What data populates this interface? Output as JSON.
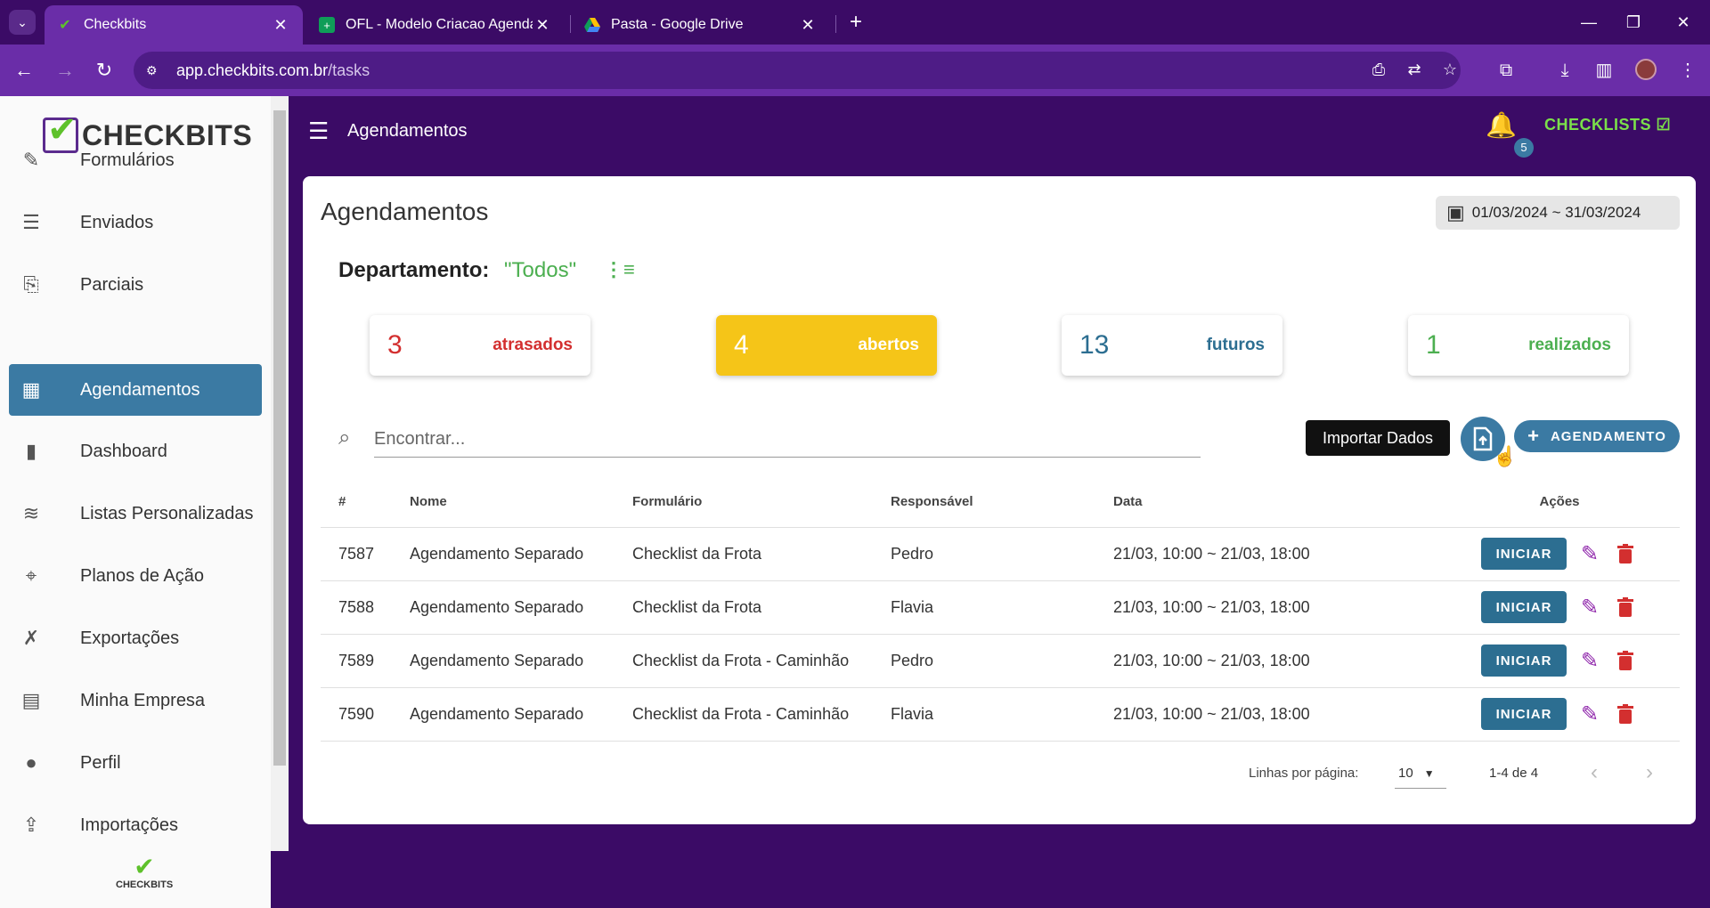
{
  "browser": {
    "tabs": [
      {
        "title": "Checkbits",
        "active": true
      },
      {
        "title": "OFL - Modelo Criacao Agendam",
        "active": false
      },
      {
        "title": "Pasta - Google Drive",
        "active": false
      }
    ],
    "url_host": "app.checkbits.com.br",
    "url_path": "/tasks"
  },
  "sidebar": {
    "logo_text": "CHECKBITS",
    "items": [
      {
        "label": "Formulários",
        "icon": "form-edit-icon"
      },
      {
        "label": "Enviados",
        "icon": "sent-list-icon"
      },
      {
        "label": "Parciais",
        "icon": "partial-doc-icon"
      },
      {
        "label": "Agendamentos",
        "icon": "calendar-check-icon",
        "active": true
      },
      {
        "label": "Dashboard",
        "icon": "bar-chart-icon"
      },
      {
        "label": "Listas Personalizadas",
        "icon": "database-icon"
      },
      {
        "label": "Planos de Ação",
        "icon": "crosshair-icon"
      },
      {
        "label": "Exportações",
        "icon": "excel-file-icon"
      },
      {
        "label": "Minha Empresa",
        "icon": "building-icon"
      },
      {
        "label": "Perfil",
        "icon": "person-icon"
      },
      {
        "label": "Importações",
        "icon": "file-import-icon"
      }
    ],
    "footer_logo_text": "CHECKBITS"
  },
  "header": {
    "title": "Agendamentos",
    "notifications_count": "5",
    "checklists_label": "CHECKLISTS"
  },
  "main": {
    "title": "Agendamentos",
    "date_range": "01/03/2024 ~ 31/03/2024",
    "department_label": "Departamento:",
    "department_value": "\"Todos\"",
    "stats": [
      {
        "count": "3",
        "label": "atrasados",
        "color": "#d32f2f"
      },
      {
        "count": "4",
        "label": "abertos",
        "color": "#f5c518"
      },
      {
        "count": "13",
        "label": "futuros",
        "color": "#2c6e91"
      },
      {
        "count": "1",
        "label": "realizados",
        "color": "#4caf50"
      }
    ],
    "search_placeholder": "Encontrar...",
    "tooltip": "Importar Dados",
    "add_button_label": "AGENDAMENTO",
    "table": {
      "columns": [
        "#",
        "Nome",
        "Formulário",
        "Responsável",
        "Data",
        "Ações"
      ],
      "rows": [
        {
          "id": "7587",
          "name": "Agendamento Separado",
          "form": "Checklist da Frota",
          "responsible": "Pedro",
          "date": "21/03, 10:00 ~ 21/03, 18:00"
        },
        {
          "id": "7588",
          "name": "Agendamento Separado",
          "form": "Checklist da Frota",
          "responsible": "Flavia",
          "date": "21/03, 10:00 ~ 21/03, 18:00"
        },
        {
          "id": "7589",
          "name": "Agendamento Separado",
          "form": "Checklist da Frota - Caminhão",
          "responsible": "Pedro",
          "date": "21/03, 10:00 ~ 21/03, 18:00"
        },
        {
          "id": "7590",
          "name": "Agendamento Separado",
          "form": "Checklist da Frota - Caminhão",
          "responsible": "Flavia",
          "date": "21/03, 10:00 ~ 21/03, 18:00"
        }
      ],
      "start_label": "INICIAR"
    },
    "pagination": {
      "rows_per_page_label": "Linhas por página:",
      "rows_per_page": "10",
      "range": "1-4 de 4"
    }
  },
  "colors": {
    "brand_purple": "#3b0b66",
    "accent_blue": "#3b7aa3",
    "green": "#4caf50"
  }
}
